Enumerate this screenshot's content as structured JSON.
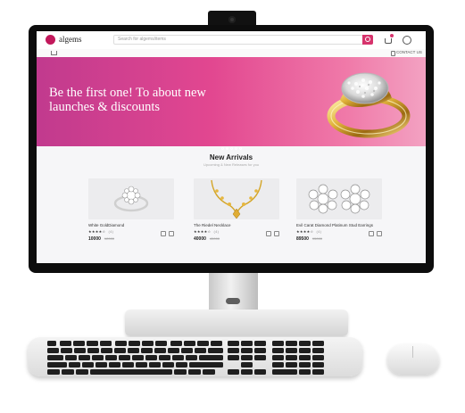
{
  "header": {
    "brand": "algems",
    "search_placeholder": "Search for algems/items",
    "contact_label": "CONTACT US"
  },
  "hero": {
    "headline": "Be the first one! To about new launches & discounts",
    "slides": 5,
    "active_slide": 2
  },
  "new_arrivals": {
    "title": "New Arrivals",
    "subtitle": "Upcoming & New Releases for you",
    "products": [
      {
        "name": "White GoldDiamond",
        "rating": 4,
        "rating_count": "(4)",
        "price": "10000",
        "mrp": "12000"
      },
      {
        "name": "The Riedel Necklace",
        "rating": 4,
        "rating_count": "(4)",
        "price": "40000",
        "mrp": "45000"
      },
      {
        "name": "Evil Carat Diamond Platinum Stud Earrings",
        "rating": 4,
        "rating_count": "(4)",
        "price": "89500",
        "mrp": "95000"
      }
    ]
  },
  "icons": {
    "cart": "cart-icon",
    "user": "user-icon",
    "search": "search-icon",
    "home": "home-icon",
    "phone": "phone-icon",
    "wishlist": "heart-icon",
    "share": "share-icon"
  },
  "colors": {
    "accent": "#d6336c",
    "hero_start": "#c13a8e",
    "hero_end": "#f3a2c2"
  }
}
